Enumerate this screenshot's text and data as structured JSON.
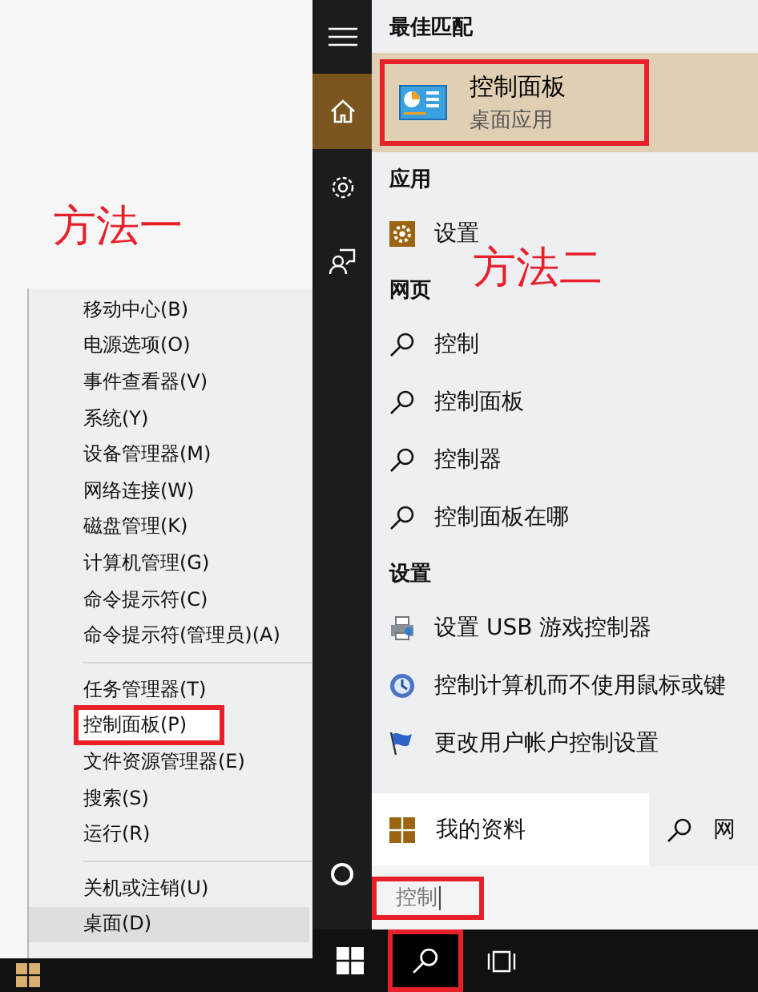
{
  "left": {
    "annotation": "方法一",
    "context_menu": {
      "groups": [
        [
          {
            "label": "移动中心(B)",
            "selected": false,
            "annotated": false
          },
          {
            "label": "电源选项(O)",
            "selected": false,
            "annotated": false
          },
          {
            "label": "事件查看器(V)",
            "selected": false,
            "annotated": false
          },
          {
            "label": "系统(Y)",
            "selected": false,
            "annotated": false
          },
          {
            "label": "设备管理器(M)",
            "selected": false,
            "annotated": false
          },
          {
            "label": "网络连接(W)",
            "selected": false,
            "annotated": false
          },
          {
            "label": "磁盘管理(K)",
            "selected": false,
            "annotated": false
          },
          {
            "label": "计算机管理(G)",
            "selected": false,
            "annotated": false
          },
          {
            "label": "命令提示符(C)",
            "selected": false,
            "annotated": false
          },
          {
            "label": "命令提示符(管理员)(A)",
            "selected": false,
            "annotated": false
          }
        ],
        [
          {
            "label": "任务管理器(T)",
            "selected": false,
            "annotated": false
          },
          {
            "label": "控制面板(P)",
            "selected": false,
            "annotated": true
          },
          {
            "label": "文件资源管理器(E)",
            "selected": false,
            "annotated": false
          },
          {
            "label": "搜索(S)",
            "selected": false,
            "annotated": false
          },
          {
            "label": "运行(R)",
            "selected": false,
            "annotated": false
          }
        ],
        [
          {
            "label": "关机或注销(U)",
            "selected": false,
            "annotated": false
          },
          {
            "label": "桌面(D)",
            "selected": true,
            "annotated": false
          }
        ]
      ]
    }
  },
  "right": {
    "annotation": "方法二",
    "sidebar": [
      {
        "kind": "menu",
        "selected": false
      },
      {
        "kind": "home",
        "selected": true
      },
      {
        "kind": "settings",
        "selected": false
      },
      {
        "kind": "feedback",
        "selected": false
      }
    ],
    "sections": [
      {
        "title": "最佳匹配",
        "results": [
          {
            "kind": "best",
            "title": "控制面板",
            "subtitle": "桌面应用",
            "annotated": true
          }
        ]
      },
      {
        "title": "应用",
        "results": [
          {
            "kind": "settings-app",
            "title": "设置"
          }
        ]
      },
      {
        "title": "网页",
        "results": [
          {
            "kind": "web",
            "title": "控制"
          },
          {
            "kind": "web",
            "title": "控制面板"
          },
          {
            "kind": "web",
            "title": "控制器"
          },
          {
            "kind": "web",
            "title": "控制面板在哪"
          }
        ]
      },
      {
        "title": "设置",
        "results": [
          {
            "kind": "usb",
            "title": "设置 USB 游戏控制器"
          },
          {
            "kind": "access",
            "title": "控制计算机而不使用鼠标或键"
          },
          {
            "kind": "uac",
            "title": "更改用户帐户控制设置"
          }
        ]
      }
    ],
    "bottom_tabs": [
      {
        "kind": "windows",
        "label": "我的资料",
        "selected": true
      },
      {
        "kind": "web",
        "label": "网",
        "selected": false
      }
    ],
    "search": {
      "value": "控制",
      "annotated": true
    },
    "taskbar": [
      {
        "kind": "start",
        "annotated": false
      },
      {
        "kind": "search",
        "annotated": true
      },
      {
        "kind": "taskview",
        "annotated": false
      }
    ]
  }
}
